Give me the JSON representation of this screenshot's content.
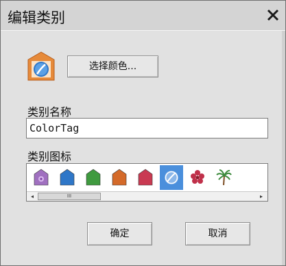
{
  "dialog": {
    "title": "编辑类别",
    "close_glyph": "✕",
    "choose_color_label": "选择颜色...",
    "category_name_label": "类别名称",
    "category_name_value": "ColorTag",
    "category_icon_label": "类别图标",
    "ok_label": "确定",
    "cancel_label": "取消"
  },
  "icons": [
    {
      "name": "purple-tag-icon",
      "color": "#a070c0",
      "selected": false
    },
    {
      "name": "blue-tag-icon",
      "color": "#2f77c8",
      "selected": false
    },
    {
      "name": "green-tag-icon",
      "color": "#3f9a3f",
      "selected": false
    },
    {
      "name": "orange-tag-icon",
      "color": "#d46a2a",
      "selected": false
    },
    {
      "name": "red-tag-icon",
      "color": "#c93a52",
      "selected": false
    },
    {
      "name": "ball-icon",
      "color": "#2f77c8",
      "selected": true
    },
    {
      "name": "flower-icon",
      "color": "#c0304a",
      "selected": false
    },
    {
      "name": "palm-tree-icon",
      "color": "#3c8a3c",
      "selected": false
    }
  ],
  "scrollbar": {
    "thumb_glyph": "III",
    "left_glyph": "◂",
    "right_glyph": "▸"
  },
  "colors": {
    "accent": "#4a8fdc",
    "preview_tag": "#e68a3a"
  }
}
